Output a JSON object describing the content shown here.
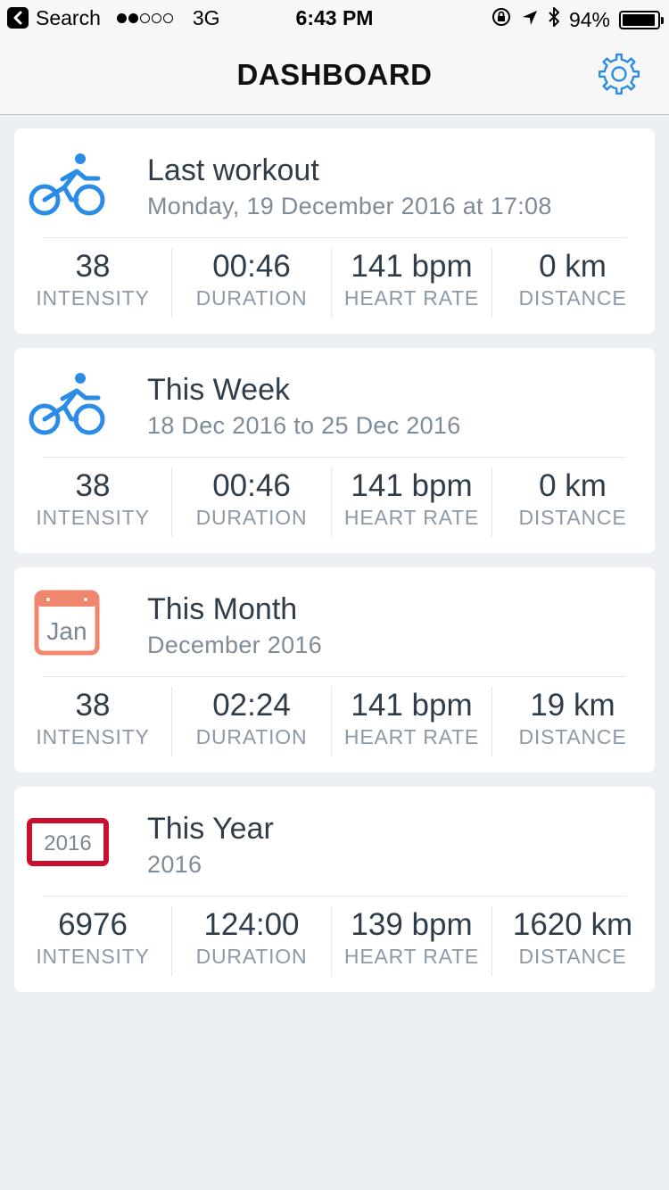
{
  "status_bar": {
    "back_label": "Search",
    "network": "3G",
    "time": "6:43 PM",
    "battery": "94%",
    "battery_level": 0.94
  },
  "nav": {
    "title": "DASHBOARD",
    "settings_icon": "gear-icon"
  },
  "colors": {
    "accent_blue": "#2a8ce6",
    "calendar_orange": "#f0866e",
    "year_red": "#c8102e"
  },
  "cards": [
    {
      "icon": "bicycle-icon",
      "title": "Last workout",
      "subtitle": "Monday, 19 December 2016 at 17:08",
      "stats": [
        {
          "value": "38",
          "label": "INTENSITY"
        },
        {
          "value": "00:46",
          "label": "DURATION"
        },
        {
          "value": "141 bpm",
          "label": "HEART RATE"
        },
        {
          "value": "0 km",
          "label": "DISTANCE"
        }
      ]
    },
    {
      "icon": "bicycle-icon",
      "title": "This Week",
      "subtitle": "18 Dec 2016 to 25 Dec 2016",
      "stats": [
        {
          "value": "38",
          "label": "INTENSITY"
        },
        {
          "value": "00:46",
          "label": "DURATION"
        },
        {
          "value": "141 bpm",
          "label": "HEART RATE"
        },
        {
          "value": "0 km",
          "label": "DISTANCE"
        }
      ]
    },
    {
      "icon": "calendar-month-icon",
      "icon_text": "Jan",
      "title": "This Month",
      "subtitle": "December 2016",
      "stats": [
        {
          "value": "38",
          "label": "INTENSITY"
        },
        {
          "value": "02:24",
          "label": "DURATION"
        },
        {
          "value": "141 bpm",
          "label": "HEART RATE"
        },
        {
          "value": "19 km",
          "label": "DISTANCE"
        }
      ]
    },
    {
      "icon": "calendar-year-icon",
      "icon_text": "2016",
      "title": "This Year",
      "subtitle": "2016",
      "stats": [
        {
          "value": "6976",
          "label": "INTENSITY"
        },
        {
          "value": "124:00",
          "label": "DURATION"
        },
        {
          "value": "139 bpm",
          "label": "HEART RATE"
        },
        {
          "value": "1620 km",
          "label": "DISTANCE"
        }
      ]
    }
  ]
}
